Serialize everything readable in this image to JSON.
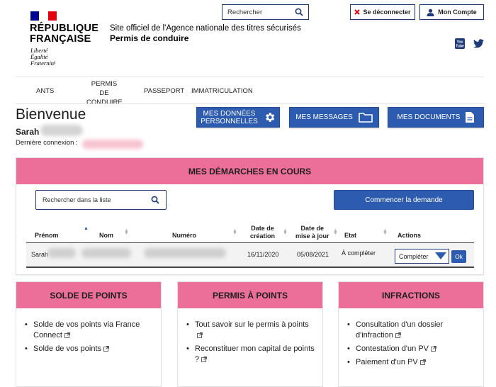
{
  "header": {
    "republic_line1": "RÉPUBLIQUE",
    "republic_line2": "FRANÇAISE",
    "motto_1": "Liberté",
    "motto_2": "Égalité",
    "motto_3": "Fraternité",
    "site_official": "Site officiel de l'Agence nationale des titres sécurisés",
    "site_name": "Permis de conduire",
    "search_placeholder": "Rechercher",
    "logout_label": "Se déconnecter",
    "account_label": "Mon Compte",
    "youtube_text": "You Tube"
  },
  "nav": {
    "items": [
      {
        "label": "ANTS"
      },
      {
        "label_1": "PERMIS DE",
        "label_2": "CONDUIRE"
      },
      {
        "label": "PASSEPORT"
      },
      {
        "label": "IMMATRICULATION"
      }
    ]
  },
  "welcome": {
    "title": "Bienvenue",
    "user_first_name": "Sarah",
    "last_connection_label": "Dernière connexion :"
  },
  "actions": {
    "personal_data_1": "MES DONNÉES",
    "personal_data_2": "PERSONNELLES",
    "messages": "MES MESSAGES",
    "documents": "MES DOCUMENTS"
  },
  "demarches": {
    "title": "MES DÉMARCHES EN COURS",
    "search_placeholder": "Rechercher dans la liste",
    "start_button": "Commencer la demande",
    "columns": {
      "prenom": "Prénom",
      "nom": "Nom",
      "numero": "Numéro",
      "date_creation_1": "Date de",
      "date_creation_2": "création",
      "date_maj_1": "Date de",
      "date_maj_2": "mise à jour",
      "etat": "Etat",
      "actions": "Actions"
    },
    "rows": [
      {
        "prenom": "Sarah",
        "date_creation": "16/11/2020",
        "date_maj": "05/08/2021",
        "etat": "À compléter",
        "action_selected": "Compléter",
        "ok": "Ok"
      }
    ]
  },
  "cards": [
    {
      "title": "SOLDE DE POINTS",
      "links": [
        "Solde de vos points via France Connect",
        "Solde de vos points"
      ]
    },
    {
      "title": "PERMIS À POINTS",
      "links": [
        "Tout savoir sur le permis à points",
        "Reconstituer mon capital de points ?"
      ]
    },
    {
      "title": "INFRACTIONS",
      "links": [
        "Consultation d'un dossier d'infraction",
        "Contestation d'un PV",
        "Paiement d'un PV"
      ]
    }
  ],
  "colors": {
    "accent_pink": "#ec6f9a",
    "primary_blue": "#2d5bb0",
    "logout_red": "#e1000f"
  }
}
